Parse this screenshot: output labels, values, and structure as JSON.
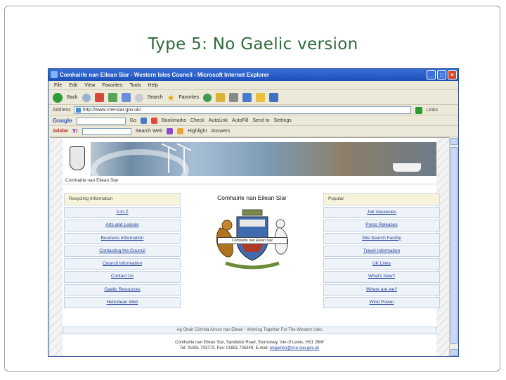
{
  "slide": {
    "title": "Type 5: No Gaelic version"
  },
  "window": {
    "title": "Comhairle nan Eilean Siar - Western Isles Council - Microsoft Internet Explorer"
  },
  "menu": [
    "File",
    "Edit",
    "View",
    "Favorites",
    "Tools",
    "Help"
  ],
  "toolbar": {
    "back": "Back",
    "search": "Search",
    "favorites": "Favorites"
  },
  "address": {
    "label": "Address",
    "value": "http://www.cne-siar.gov.uk/",
    "links": "Links"
  },
  "googlebar": {
    "brand": "Google",
    "go": "Go",
    "bookmarks": "Bookmarks",
    "check": "Check",
    "autolink": "AutoLink",
    "autofill": "AutoFill",
    "sendto": "Send to",
    "settings": "Settings"
  },
  "yahoobar": {
    "adobe": "Adobe",
    "yahoo": "Y!",
    "search": "Search Web",
    "highlight": "Highlight",
    "answers": "Answers"
  },
  "site": {
    "breadcrumb": "Comhairle nan Eilean Siar",
    "center_title": "Comhairle nan Eilean Siar",
    "arms_label": "Comhairle nan Eilean Siar",
    "left_header": "Recycling Information",
    "left_nav": [
      "A to Z",
      "Arts and Leisure",
      "Business Information",
      "Contacting the Council",
      "Council Information",
      "Contact Us",
      "Gaelic Resources",
      "Hebridean Web"
    ],
    "right_header": "Popular",
    "right_nav": [
      "Job Vacancies",
      "Press Releases",
      "Site Search Facility",
      "Travel Information",
      "UK Links",
      "What's New?",
      "Where are we?",
      "Wind Power"
    ],
    "footer_bar": "Ag Obair Còmhla Airson nan Eilean - Working Together For The Western Isles",
    "footer_line1": "Comhairle nan Eilean Siar, Sandwick Road, Stornoway, Isle of Lewis, HS1 2BW",
    "footer_line2_prefix": "Tel: 01851 703773, Fax: 01851 705349, E-mail:",
    "footer_email": "enquiries@cne-siar.gov.uk"
  },
  "colors": {
    "title_green": "#2e6b3a",
    "link_blue": "#1f3f9a",
    "titlebar_blue": "#1d4fb8",
    "header_cream": "#f7f3da"
  }
}
